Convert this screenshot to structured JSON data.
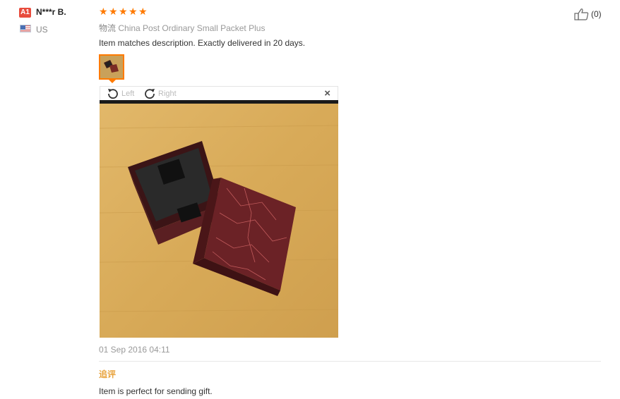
{
  "user": {
    "level_badge": "A1",
    "name": "N***r B.",
    "country": "US",
    "flag_icon": "us-flag-icon"
  },
  "rating": {
    "stars": 5,
    "max": 5,
    "color": "#ff7a00"
  },
  "logistics": {
    "label": "物流",
    "method": "China Post Ordinary Small Packet Plus"
  },
  "review": {
    "text": "Item matches description. Exactly delivered in 20 days.",
    "date": "01 Sep 2016 04:11"
  },
  "viewer": {
    "rotate_left": "Left",
    "rotate_right": "Right",
    "close": "×"
  },
  "helpful": {
    "count": "(0)",
    "icon": "thumbs-up-icon"
  },
  "additional_feedback": {
    "label": "追评",
    "text": "Item is perfect for sending gift."
  },
  "colors": {
    "accent": "#ff7a00",
    "badge": "#e84c3d",
    "append_label": "#e8a33d"
  }
}
